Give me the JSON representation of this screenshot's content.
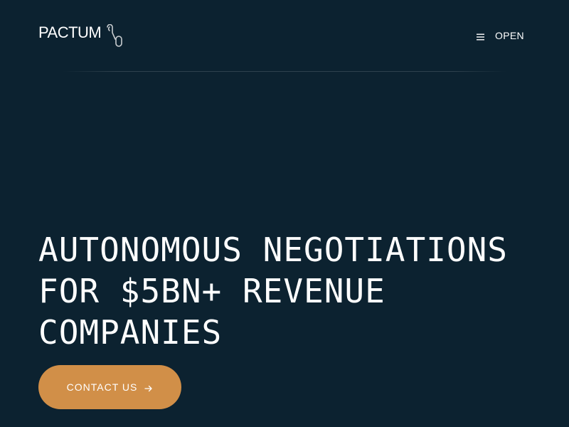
{
  "header": {
    "logo_text": "PACTUM",
    "menu_label": "OPEN",
    "menu_icon": "hamburger-icon",
    "logo_icon": "pactum-logo-mark"
  },
  "hero": {
    "headline_lines": [
      "AUTONOMOUS NEGOTIATIONS",
      "FOR $5BN+ REVENUE",
      "COMPANIES"
    ],
    "cta_label": "CONTACT US",
    "cta_icon": "arrow-right-icon"
  },
  "colors": {
    "background": "#0c2230",
    "accent": "#d18f48",
    "text": "#ffffff"
  }
}
